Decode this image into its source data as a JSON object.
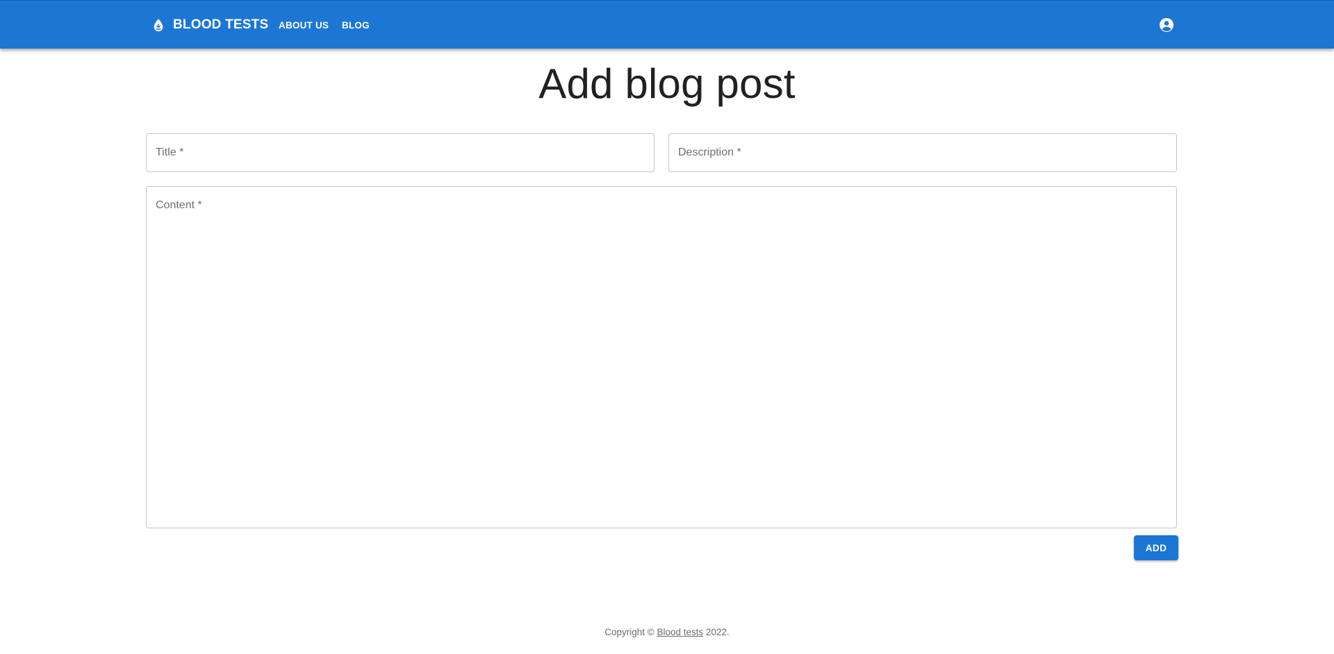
{
  "appbar": {
    "brand_icon": "blood-drop-icon",
    "brand_label": "BLOOD TESTS",
    "nav": {
      "about_label": "ABOUT US",
      "blog_label": "BLOG"
    },
    "account_icon": "account-circle-icon",
    "background_color": "#1c77d4"
  },
  "page": {
    "title": "Add blog post"
  },
  "form": {
    "title_label": "Title *",
    "title_value": "",
    "description_label": "Description *",
    "description_value": "",
    "content_label": "Content *",
    "content_value": "",
    "submit_label": "ADD"
  },
  "footer": {
    "prefix": "Copyright © ",
    "link_label": "Blood tests",
    "suffix": " 2022."
  }
}
